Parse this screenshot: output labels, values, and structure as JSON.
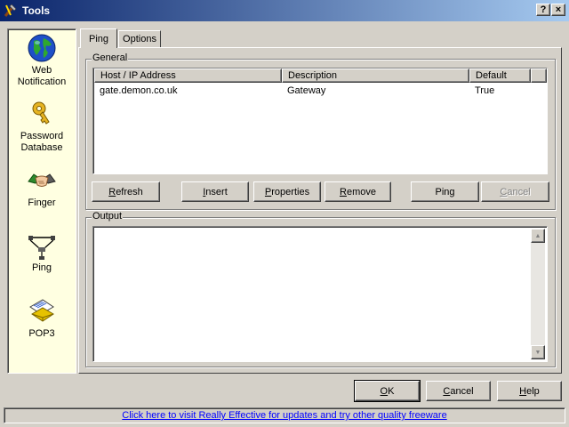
{
  "window": {
    "title": "Tools",
    "help_btn": "?",
    "close_btn": "×"
  },
  "sidebar": {
    "items": [
      {
        "label_lines": [
          "Web",
          "Notification"
        ],
        "icon": "globe-icon",
        "selected": false
      },
      {
        "label_lines": [
          "Password",
          "Database"
        ],
        "icon": "key-icon",
        "selected": false
      },
      {
        "label_lines": [
          "Finger"
        ],
        "icon": "handshake-icon",
        "selected": false
      },
      {
        "label_lines": [
          "Ping"
        ],
        "icon": "network-icon",
        "selected": true
      },
      {
        "label_lines": [
          "POP3"
        ],
        "icon": "mail-icon",
        "selected": false
      }
    ]
  },
  "tabs": [
    {
      "label": "Ping",
      "active": true
    },
    {
      "label": "Options",
      "active": false
    }
  ],
  "general": {
    "label": "General",
    "columns": [
      "Host / IP Address",
      "Description",
      "Default"
    ],
    "rows": [
      {
        "host": "gate.demon.co.uk",
        "description": "Gateway",
        "default": "True"
      }
    ]
  },
  "actions": {
    "refresh": {
      "pre": "",
      "ul": "R",
      "post": "efresh"
    },
    "insert": {
      "pre": "",
      "ul": "I",
      "post": "nsert"
    },
    "properties": {
      "pre": "",
      "ul": "P",
      "post": "roperties"
    },
    "remove": {
      "pre": "",
      "ul": "R",
      "post": "emove"
    },
    "ping": {
      "pre": "Pin",
      "ul": "g",
      "post": ""
    },
    "cancel": {
      "pre": "",
      "ul": "C",
      "post": "ancel",
      "disabled": true
    }
  },
  "output": {
    "label": "Output",
    "text": ""
  },
  "dialog": {
    "ok": {
      "pre": "",
      "ul": "O",
      "post": "K",
      "default": true
    },
    "cancel": {
      "pre": "",
      "ul": "C",
      "post": "ancel"
    },
    "help": {
      "pre": "",
      "ul": "H",
      "post": "elp"
    }
  },
  "status": {
    "link": "Click here to visit Really Effective for updates and try other quality freeware"
  },
  "colors": {
    "titlebar_start": "#0a246a",
    "titlebar_end": "#a6caf0",
    "sidebar_bg": "#ffffe1",
    "link": "#0000ff"
  }
}
